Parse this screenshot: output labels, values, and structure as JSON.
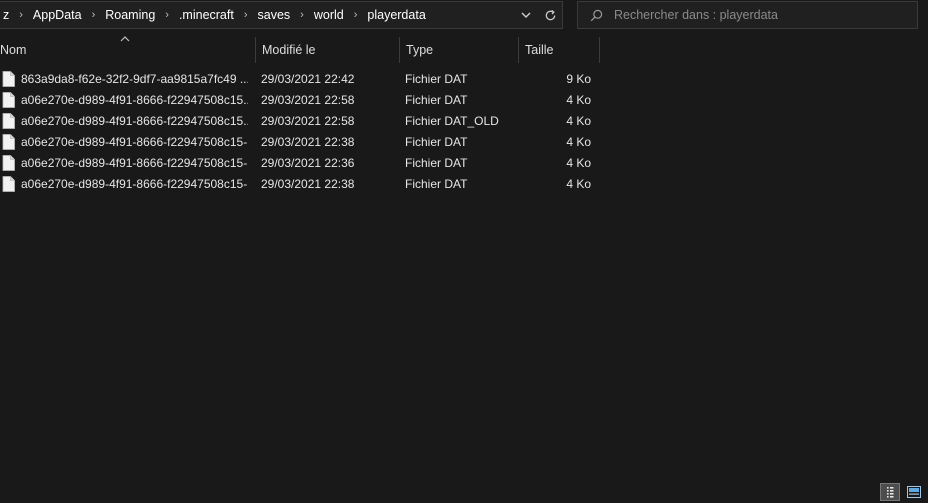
{
  "breadcrumb": {
    "items": [
      "z",
      "AppData",
      "Roaming",
      ".minecraft",
      "saves",
      "world",
      "playerdata"
    ]
  },
  "search": {
    "placeholder": "Rechercher dans : playerdata"
  },
  "columns": {
    "name": "Nom",
    "modified": "Modifié le",
    "type": "Type",
    "size": "Taille"
  },
  "files": [
    {
      "name": "863a9da8-f62e-32f2-9df7-aa9815a7fc49 ....",
      "modified": "29/03/2021 22:42",
      "type": "Fichier DAT",
      "size": "9 Ko"
    },
    {
      "name": "a06e270e-d989-4f91-8666-f22947508c15....",
      "modified": "29/03/2021 22:58",
      "type": "Fichier DAT",
      "size": "4 Ko"
    },
    {
      "name": "a06e270e-d989-4f91-8666-f22947508c15....",
      "modified": "29/03/2021 22:58",
      "type": "Fichier DAT_OLD",
      "size": "4 Ko"
    },
    {
      "name": "a06e270e-d989-4f91-8666-f22947508c15-...",
      "modified": "29/03/2021 22:38",
      "type": "Fichier DAT",
      "size": "4 Ko"
    },
    {
      "name": "a06e270e-d989-4f91-8666-f22947508c15-...",
      "modified": "29/03/2021 22:36",
      "type": "Fichier DAT",
      "size": "4 Ko"
    },
    {
      "name": "a06e270e-d989-4f91-8666-f22947508c15-...",
      "modified": "29/03/2021 22:38",
      "type": "Fichier DAT",
      "size": "4 Ko"
    }
  ],
  "icons": {
    "file": "file-icon",
    "dropdown": "chevron-down-icon",
    "refresh": "refresh-icon",
    "search": "search-icon",
    "sort": "sort-ascending-icon",
    "details_view": "details-view-icon",
    "tiles_view": "tiles-view-icon"
  },
  "colors": {
    "background": "#191919",
    "text": "#ffffff",
    "placeholder": "#8a8a8a",
    "border": "#3a3a3a"
  }
}
